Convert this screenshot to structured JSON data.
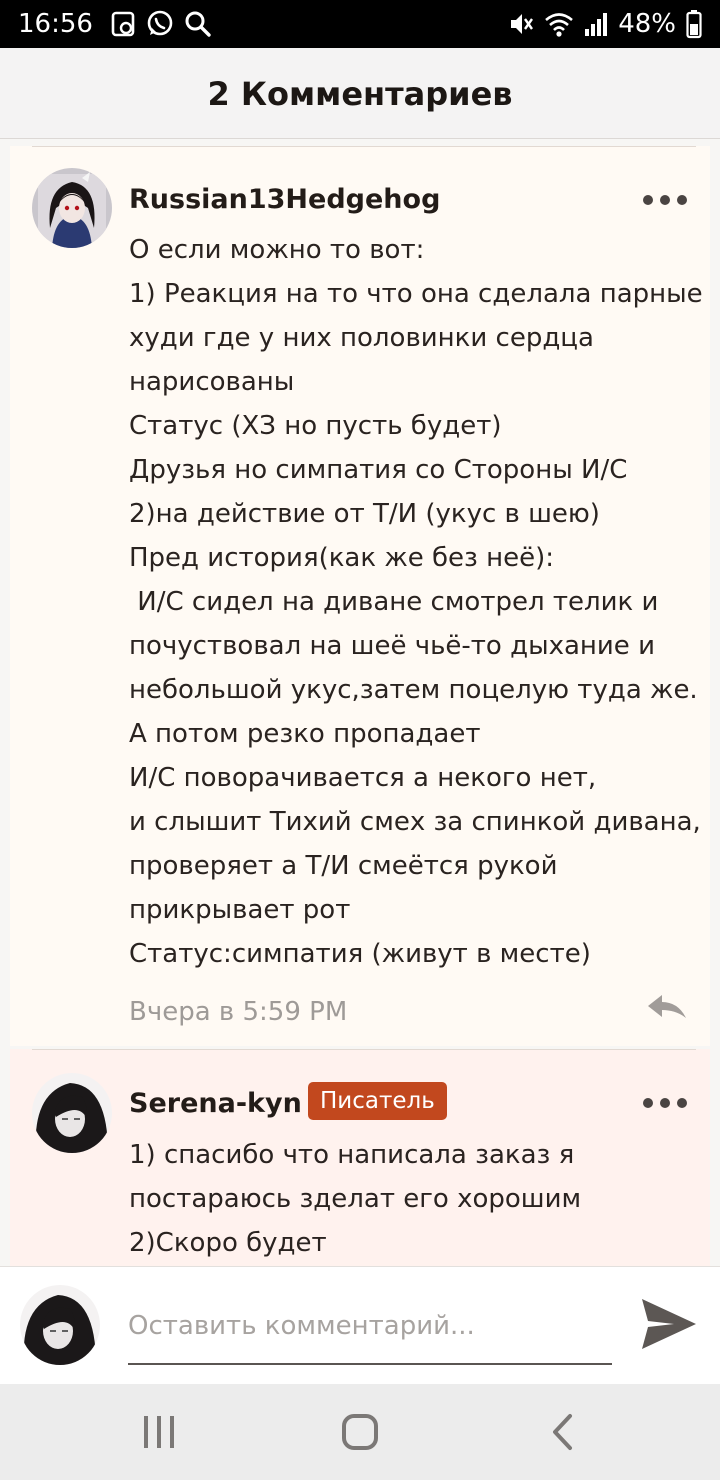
{
  "status_bar": {
    "time": "16:56",
    "battery": "48%",
    "left_icons": [
      "gallery-notification-icon",
      "whatsapp-icon",
      "search-icon"
    ],
    "right_icons": [
      "mute-icon",
      "wifi-icon",
      "signal-icon"
    ]
  },
  "header": {
    "title": "2 Комментариев"
  },
  "comments": [
    {
      "username": "Russian13Hedgehog",
      "badge": "",
      "text": "О если можно то вот:\n1) Реакция на то что она сделала парные худи где у них половинки сердца нарисованы\nСтатус (ХЗ но пусть будет)\nДрузья но симпатия со Стороны И/С\n2)на действие от Т/И (укус в шею)\nПред история(как же без неё):\n И/С сидел на диване смотрел телик и почуствовал на шеё чьё-то дыхание и небольшой укус,затем поцелую туда же.\nА потом резко пропадает\nИ/С поворачивается а некого нет,\nи слышит Тихий смех за спинкой дивана, проверяет а Т/И смеётся рукой прикрывает рот\nСтатус:симпатия (живут в месте)",
      "time": "Вчера в 5:59 PM",
      "background": "#fffaf4"
    },
    {
      "username": "Serena-kyn",
      "badge": "Писатель",
      "text": "1) спасибо что написала заказ я постараюсь зделат его хорошим\n2)Скоро будет",
      "time": "",
      "background": "#fff2ee"
    }
  ],
  "compose": {
    "placeholder": "Оставить комментарий..."
  },
  "nav_bar": {
    "buttons": [
      "recent-apps-icon",
      "home-icon",
      "back-icon"
    ]
  },
  "colors": {
    "badge": "#c2481e",
    "status_bar": "#000000",
    "muted_text": "#9e9a97"
  }
}
